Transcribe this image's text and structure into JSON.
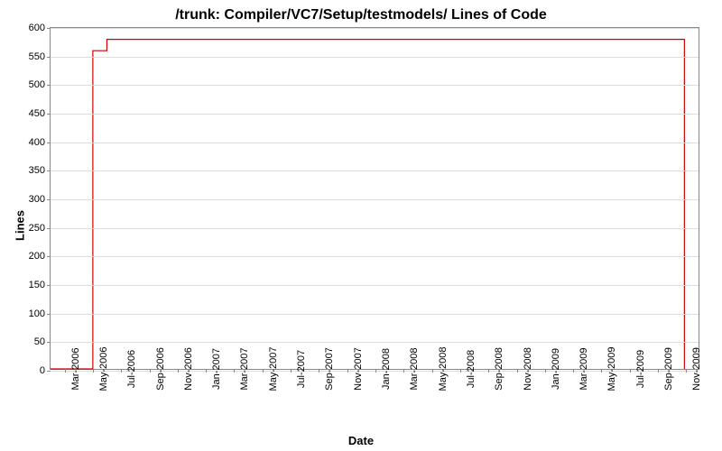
{
  "chart_data": {
    "type": "line",
    "title": "/trunk: Compiler/VC7/Setup/testmodels/ Lines of Code",
    "xlabel": "Date",
    "ylabel": "Lines",
    "ylim": [
      0,
      600
    ],
    "y_ticks": [
      0,
      50,
      100,
      150,
      200,
      250,
      300,
      350,
      400,
      450,
      500,
      550,
      600
    ],
    "x_ticks": [
      "Mar-2006",
      "May-2006",
      "Jul-2006",
      "Sep-2006",
      "Nov-2006",
      "Jan-2007",
      "Mar-2007",
      "May-2007",
      "Jul-2007",
      "Sep-2007",
      "Nov-2007",
      "Jan-2008",
      "Mar-2008",
      "May-2008",
      "Jul-2008",
      "Sep-2008",
      "Nov-2008",
      "Jan-2009",
      "Mar-2009",
      "May-2009",
      "Jul-2009",
      "Sep-2009",
      "Nov-2009"
    ],
    "series": [
      {
        "name": "Lines of Code",
        "points": [
          {
            "x": "Feb-2006",
            "y": 0
          },
          {
            "x": "May-2006",
            "y": 0
          },
          {
            "x": "May-2006",
            "y": 560
          },
          {
            "x": "Jun-2006",
            "y": 560
          },
          {
            "x": "Jun-2006",
            "y": 580
          },
          {
            "x": "Nov-2009",
            "y": 580
          },
          {
            "x": "Nov-2009",
            "y": 0
          }
        ]
      }
    ],
    "colors": {
      "line": "#cc0000"
    }
  }
}
